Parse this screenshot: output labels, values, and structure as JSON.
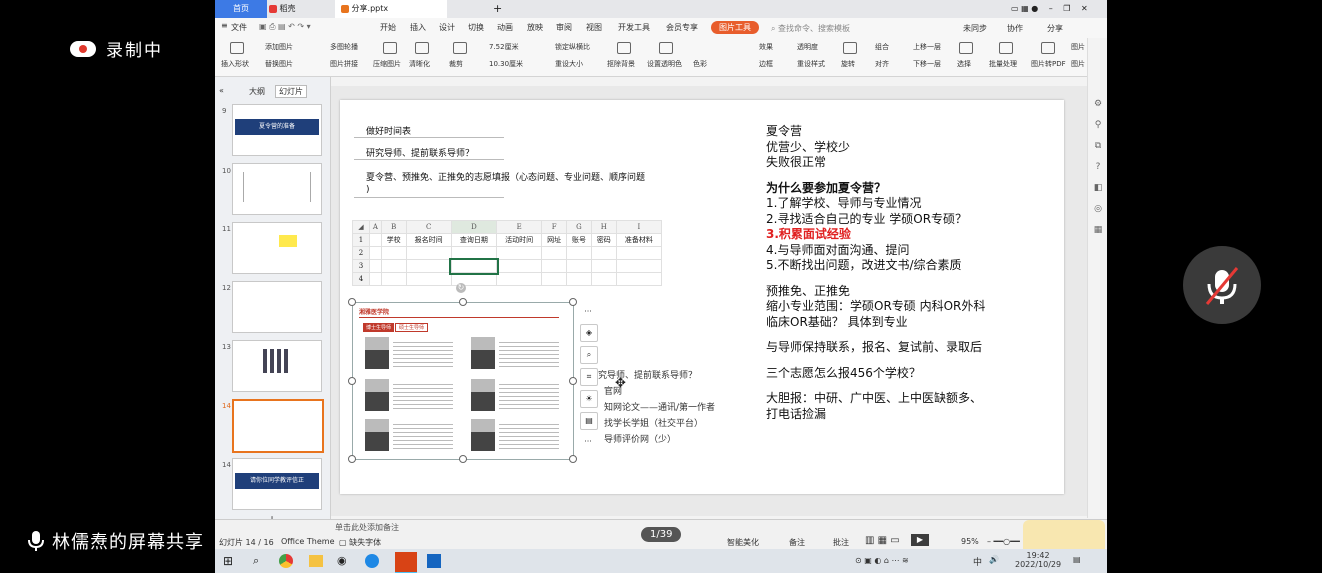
{
  "overlay": {
    "recording_label": "录制中",
    "screen_share_label": "林儒焘的屏幕共享"
  },
  "window": {
    "tabs": [
      "首页",
      "稻壳",
      "分享.pptx"
    ],
    "menu": [
      "文件",
      "开始",
      "插入",
      "设计",
      "切换",
      "动画",
      "放映",
      "审阅",
      "视图",
      "开发工具",
      "会员专享",
      "图片工具"
    ],
    "search_placeholder": "查找命令、搜索模板",
    "top_right": [
      "未同步",
      "协作",
      "分享"
    ],
    "toolbar_row1": [
      "添加图片",
      "多图轮播",
      "7.52厘米",
      "锁定纵横比",
      "效果",
      "透明度",
      "组合",
      "上移一层",
      "批量处理",
      "图片转PDF",
      "图片"
    ],
    "toolbar_row2": [
      "插入形状",
      "替换图片",
      "图片拼接",
      "压缩图片",
      "清晰化",
      "裁剪",
      "10.30厘米",
      "重设大小",
      "抠除背景",
      "设置透明色",
      "色彩",
      "边框",
      "重设样式",
      "旋转",
      "对齐",
      "下移一层",
      "选择",
      "批量处理",
      "图片转PDF",
      "图片"
    ]
  },
  "panel": {
    "tabs": [
      "大纲",
      "幻灯片"
    ],
    "slides": [
      {
        "num": "9",
        "title": "夏令营的准备"
      },
      {
        "num": "10",
        "title": ""
      },
      {
        "num": "11",
        "title": ""
      },
      {
        "num": "12",
        "title": ""
      },
      {
        "num": "13",
        "title": ""
      },
      {
        "num": "14",
        "title": ""
      },
      {
        "num": "14",
        "title": "请你位同学教评信正"
      }
    ]
  },
  "slide": {
    "left_items": [
      "做好时间表",
      "研究导师、提前联系导师？",
      "夏令营、预推免、正推免的志愿填报（心态问题、专业问题、顺序问题",
      ")"
    ],
    "sheet_cols": [
      "A",
      "B",
      "C",
      "D",
      "E",
      "F",
      "G",
      "H",
      "I"
    ],
    "sheet_headers": [
      "学校",
      "报名时间",
      "查询日期",
      "活动时间",
      "网址",
      "账号",
      "密码",
      "准备材料"
    ],
    "sheet_rows": [
      "1",
      "2",
      "3",
      "4"
    ],
    "image_header": "湘雅医学院",
    "image_tabs": [
      "博士生导师",
      "硕士生导师"
    ],
    "behind_list": [
      "究导师、提前联系导师？",
      "官网",
      "知网论文——通讯/第一作者",
      "找学长学姐（社交平台）",
      "导师评价网（少）"
    ],
    "right_lines": [
      "夏令营",
      "优营少、学校少",
      "失败很正常",
      "为什么要参加夏令营？",
      "1.了解学校、导师与专业情况",
      "2.寻找适合自己的专业 学硕OR专硕？",
      "3.积累面试经验",
      "4.与导师面对面沟通、提问",
      "5.不断找出问题，改进文书/综合素质",
      "预推免、正推免",
      "缩小专业范围：学硕OR专硕 内科OR外科",
      "临床OR基础？ 具体到专业",
      "与导师保持联系，报名、复试前、录取后",
      "三个志愿怎么报456个学校？",
      "大胆报：中研、广中医、上中医缺额多、",
      "打电话捡漏"
    ]
  },
  "status": {
    "notes_placeholder": "单击此处添加备注",
    "slide_counter": "幻灯片 14 / 16",
    "theme": "Office Theme",
    "missing_font": "缺失字体",
    "page_badge": "1/39",
    "smart_beautify": "智能美化",
    "notes_btn": "备注",
    "comments_btn": "批注",
    "zoom": "95%"
  },
  "taskbar": {
    "time": "19:42",
    "date": "2022/10/29",
    "ime": "中"
  },
  "colors": {
    "accent": "#e02020",
    "wps_red": "#c0392b",
    "slide_title_bar": "#1f3f7a"
  }
}
